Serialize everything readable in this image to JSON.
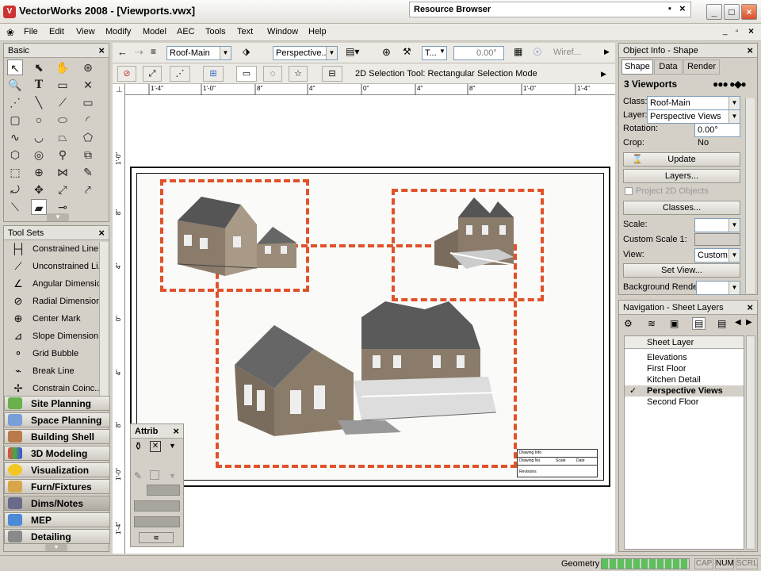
{
  "app": {
    "title": "VectorWorks 2008 - [Viewports.vwx]",
    "resource_browser": "Resource Browser"
  },
  "menu": [
    "File",
    "Edit",
    "View",
    "Modify",
    "Model",
    "AEC",
    "Tools",
    "Text",
    "Window",
    "Help"
  ],
  "basic_palette": {
    "title": "Basic"
  },
  "tool_sets": {
    "title": "Tool Sets",
    "tools": [
      "Constrained Line...",
      "Unconstrained Li...",
      "Angular Dimension",
      "Radial Dimension",
      "Center Mark",
      "Slope Dimension",
      "Grid Bubble",
      "Break Line",
      "Constrain Coinc..."
    ],
    "palettes": [
      "Site Planning",
      "Space Planning",
      "Building Shell",
      "3D Modeling",
      "Visualization",
      "Furn/Fixtures",
      "Dims/Notes",
      "MEP",
      "Detailing"
    ]
  },
  "view_bar": {
    "layer": "Roof-Main",
    "view": "Perspective...",
    "render": "Wiref...",
    "text_style": "T...",
    "angle": "0.00°"
  },
  "mode_bar": {
    "hint": "2D Selection Tool: Rectangular Selection Mode"
  },
  "ruler_marks": [
    "1'-4\"",
    "1'-0\"",
    "8\"",
    "4\"",
    "0\"",
    "4\"",
    "8\"",
    "1'-0\"",
    "1'-4\""
  ],
  "ruler_v_marks": [
    "1'-0\"",
    "8\"",
    "4\"",
    "0\"",
    "4\"",
    "8\"",
    "1'-0\"",
    "1'-4\""
  ],
  "attributes": {
    "title": "Attrib"
  },
  "object_info": {
    "title": "Object Info - Shape",
    "tabs": [
      "Shape",
      "Data",
      "Render"
    ],
    "heading": "3 Viewports",
    "class_label": "Class:",
    "class_value": "Roof-Main",
    "layer_label": "Layer:",
    "layer_value": "Perspective Views",
    "rotation_label": "Rotation:",
    "rotation_value": "0.00°",
    "crop_label": "Crop:",
    "crop_value": "No",
    "update": "Update",
    "layers": "Layers...",
    "project2d": "Project 2D Objects",
    "classes": "Classes...",
    "scale_label": "Scale:",
    "custom_scale_label": "Custom Scale 1:",
    "view_label": "View:",
    "view_value": "Custom",
    "set_view": "Set View...",
    "bg_render_label": "Background Render:"
  },
  "navigation": {
    "title": "Navigation - Sheet Layers",
    "column": "Sheet Layer",
    "items": [
      "Elevations",
      "First Floor",
      "Kitchen Detail",
      "Perspective Views",
      "Second Floor"
    ],
    "selected": "Perspective Views",
    "check": "✓"
  },
  "status": {
    "mode": "Geometry",
    "caps": "CAP",
    "num": "NUM",
    "scrl": "SCRL"
  },
  "title_block": {
    "line1": "Drawing Info",
    "line2": "Drawing No.",
    "line3": "Scale",
    "line4": "Date",
    "line5": "Revisions"
  }
}
